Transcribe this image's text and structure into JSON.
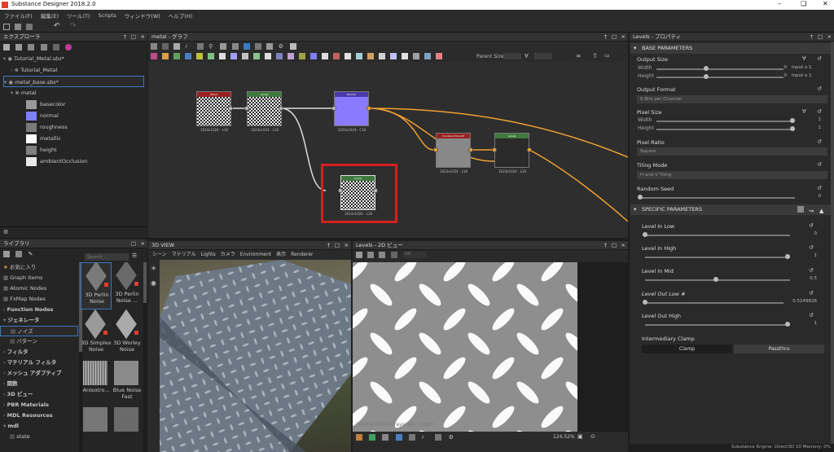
{
  "window": {
    "title": "Substance Designer 2018.2.0"
  },
  "menu": [
    "ファイル(F)",
    "編集(E)",
    "ツール(T)",
    "Scripts",
    "ウィンドウ(W)",
    "ヘルプ(H)"
  ],
  "explorer": {
    "title": "エクスプローラ",
    "items": [
      {
        "label": "Tutorial_Metal.sbs*"
      },
      {
        "label": "Tutorial_Metal"
      },
      {
        "label": "metal_base.sbs*"
      },
      {
        "label": "metal"
      }
    ],
    "outputs": [
      {
        "label": "basecolor",
        "color": "#9a9a9a"
      },
      {
        "label": "normal",
        "color": "#8080ff"
      },
      {
        "label": "roughness",
        "color": "#7a7a7a"
      },
      {
        "label": "metallic",
        "color": "#ffffff"
      },
      {
        "label": "height",
        "color": "#808080"
      },
      {
        "label": "ambientOcclusion",
        "color": "#e8e8e8"
      }
    ]
  },
  "graph": {
    "title": "metal - グラフ",
    "parent_size_label": "Parent Size:",
    "nodes": [
      {
        "name": "Blend",
        "size": "1024x1024 - L16",
        "hdr": "#9a2020"
      },
      {
        "name": "Levels",
        "size": "1024x1024 - L16",
        "hdr": "#3e7a3e"
      },
      {
        "name": "Normal",
        "size": "1024x1024 - C16",
        "hdr": "#4a3aa8"
      },
      {
        "name": "Curvature Smooth",
        "size": "1024x1024 - L16",
        "hdr": "#9a2020"
      },
      {
        "name": "Levels",
        "size": "1024x1024 - L16",
        "hdr": "#3e7a3e"
      },
      {
        "name": "Levels",
        "size": "1024x1024 - L16",
        "hdr": "#3e7a3e"
      }
    ]
  },
  "library": {
    "title": "ライブラリ",
    "search_placeholder": "Search",
    "categories": [
      "お気に入り",
      "Graph Items",
      "Atomic Nodes",
      "FxMap Nodes",
      "Function Nodes",
      "ジェネレータ",
      "ノイズ",
      "パターン",
      "フィルタ",
      "マテリアル フィルタ",
      "メッシュ アダプティブ",
      "関数",
      "3D ビュー",
      "PBR Materials",
      "MDL Resources",
      "mdl",
      "state"
    ],
    "thumbs": [
      {
        "label": "3D Perlin Noise"
      },
      {
        "label": "3D Perlin Noise ..."
      },
      {
        "label": "3D Simplex Noise"
      },
      {
        "label": "3D Worley Noise"
      },
      {
        "label": "Anisotro..."
      },
      {
        "label": "Blue Noise Fast"
      }
    ]
  },
  "view3d": {
    "title": "3D VIEW",
    "menu": [
      "シーン",
      "マテリアル",
      "Lights",
      "カメラ",
      "Environment",
      "表示",
      "Renderer"
    ]
  },
  "view2d": {
    "title": "Levels - 2D ビュー",
    "status": "1024 x 1024 (Grayscale, 16bpc)",
    "zoom": "124.52%",
    "uv_label": "UV"
  },
  "props": {
    "title": "Levels - プロパティ",
    "base_section": "BASE PARAMETERS",
    "output_size": {
      "label": "Output Size",
      "width_label": "Width",
      "height_label": "Height",
      "width_val": "0",
      "height_val": "0",
      "width_mode": "Input x 1",
      "height_mode": "Input x 1"
    },
    "output_format": {
      "label": "Output Format",
      "value": "8 Bits per Channel"
    },
    "pixel_size": {
      "label": "Pixel Size",
      "width_label": "Width",
      "height_label": "Height",
      "width_val": "1",
      "height_val": "1"
    },
    "pixel_ratio": {
      "label": "Pixel Ratio",
      "value": "Square"
    },
    "tiling_mode": {
      "label": "Tiling Mode",
      "value": "H and V Tiling"
    },
    "random_seed": {
      "label": "Random Seed",
      "value": "0"
    },
    "specific_section": "SPECIFIC PARAMETERS",
    "level_in_low": {
      "label": "Level In Low",
      "value": "0"
    },
    "level_in_high": {
      "label": "Level In High",
      "value": "1"
    },
    "level_in_mid": {
      "label": "Level In Mid",
      "value": "0.5"
    },
    "level_out_low": {
      "label": "Level Out Low #",
      "value": "0.5149626"
    },
    "level_out_high": {
      "label": "Level Out High",
      "value": "1"
    },
    "intermediary_clamp": {
      "label": "Intermediary Clamp",
      "opt1": "Clamp",
      "opt2": "Passthru"
    }
  },
  "statusbar": {
    "text": "Substance Engine: Direct3D 10   Memory: 0%"
  },
  "colors": {
    "accent": "#f0a030",
    "selection": "#d42020"
  }
}
